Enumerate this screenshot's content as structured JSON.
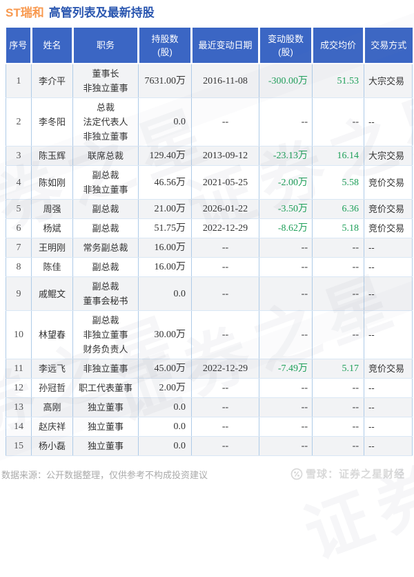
{
  "title": {
    "stock": "ST瑞和",
    "text": "高管列表及最新持股"
  },
  "colors": {
    "stock_orange": "#f8994f",
    "title_blue": "#2b57b0",
    "header_blue": "#3b66c4",
    "decrease_green": "#1fa05a",
    "row_alt_gray": "#f2f3f5",
    "grid_blue": "#aecbe8"
  },
  "table": {
    "headers": {
      "no": "序号",
      "name": "姓名",
      "position": "职务",
      "shares": "持股数\n(股)",
      "date": "最近变动日期",
      "change": "变动股数\n(股)",
      "price": "成交均价",
      "method": "交易方式"
    },
    "rows": [
      {
        "no": "1",
        "name": "李介平",
        "position": "董事长\n非独立董事",
        "shares": "7631.00万",
        "date": "2016-11-08",
        "change": "-300.00万",
        "price": "51.53",
        "method": "大宗交易"
      },
      {
        "no": "2",
        "name": "李冬阳",
        "position": "总裁\n法定代表人\n非独立董事",
        "shares": "0.0",
        "date": "--",
        "change": "--",
        "price": "--",
        "method": "--"
      },
      {
        "no": "3",
        "name": "陈玉辉",
        "position": "联席总裁",
        "shares": "129.40万",
        "date": "2013-09-12",
        "change": "-23.13万",
        "price": "16.14",
        "method": "大宗交易"
      },
      {
        "no": "4",
        "name": "陈如刚",
        "position": "副总裁\n非独立董事",
        "shares": "46.56万",
        "date": "2021-05-25",
        "change": "-2.00万",
        "price": "5.58",
        "method": "竞价交易"
      },
      {
        "no": "5",
        "name": "周强",
        "position": "副总裁",
        "shares": "21.00万",
        "date": "2026-01-22",
        "change": "-3.50万",
        "price": "6.36",
        "method": "竞价交易"
      },
      {
        "no": "6",
        "name": "杨斌",
        "position": "副总裁",
        "shares": "51.75万",
        "date": "2022-12-29",
        "change": "-8.62万",
        "price": "5.18",
        "method": "竞价交易"
      },
      {
        "no": "7",
        "name": "王明刚",
        "position": "常务副总裁",
        "shares": "16.00万",
        "date": "--",
        "change": "--",
        "price": "--",
        "method": "--"
      },
      {
        "no": "8",
        "name": "陈佳",
        "position": "副总裁",
        "shares": "16.00万",
        "date": "--",
        "change": "--",
        "price": "--",
        "method": "--"
      },
      {
        "no": "9",
        "name": "戚鲲文",
        "position": "副总裁\n董事会秘书",
        "shares": "0.0",
        "date": "--",
        "change": "--",
        "price": "--",
        "method": "--"
      },
      {
        "no": "10",
        "name": "林望春",
        "position": "副总裁\n非独立董事\n财务负责人",
        "shares": "30.00万",
        "date": "--",
        "change": "--",
        "price": "--",
        "method": "--"
      },
      {
        "no": "11",
        "name": "李远飞",
        "position": "非独立董事",
        "shares": "45.00万",
        "date": "2022-12-29",
        "change": "-7.49万",
        "price": "5.17",
        "method": "竞价交易"
      },
      {
        "no": "12",
        "name": "孙冠哲",
        "position": "职工代表董事",
        "shares": "2.00万",
        "date": "--",
        "change": "--",
        "price": "--",
        "method": "--"
      },
      {
        "no": "13",
        "name": "高刚",
        "position": "独立董事",
        "shares": "0.0",
        "date": "--",
        "change": "--",
        "price": "--",
        "method": "--"
      },
      {
        "no": "14",
        "name": "赵庆祥",
        "position": "独立董事",
        "shares": "0.0",
        "date": "--",
        "change": "--",
        "price": "--",
        "method": "--"
      },
      {
        "no": "15",
        "name": "杨小磊",
        "position": "独立董事",
        "shares": "0.0",
        "date": "--",
        "change": "--",
        "price": "--",
        "method": "--"
      }
    ]
  },
  "footer": {
    "source_note": "数据来源：公开数据整理，仅供参考不构成投资建议",
    "brand": "雪球：证券之星财经"
  },
  "watermark": {
    "text": "证券之星"
  }
}
